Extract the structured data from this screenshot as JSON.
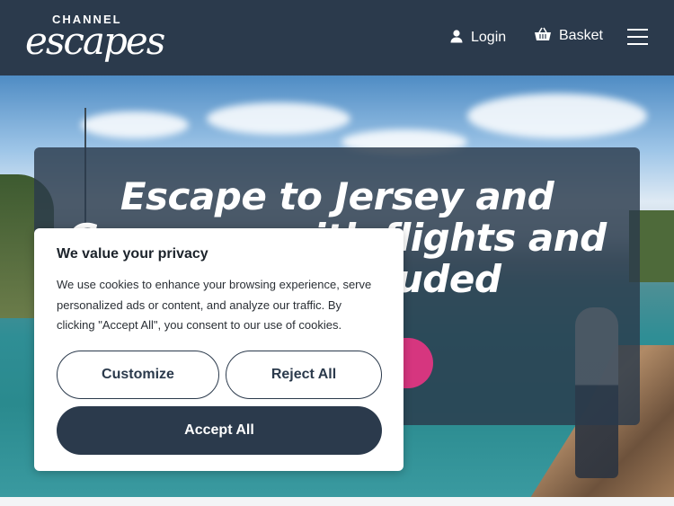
{
  "header": {
    "logo": {
      "top_text": "CHANNEL",
      "main_text": "escapes"
    },
    "login_label": "Login",
    "basket_label": "Basket",
    "icons": {
      "login": "user-icon",
      "basket": "basket-icon",
      "menu": "hamburger-menu-icon"
    }
  },
  "hero": {
    "title_lines": [
      "Escape to Jersey and",
      "Guernsey with flights and",
      "ferries included"
    ]
  },
  "cookie_banner": {
    "title": "We value your privacy",
    "body": "We use cookies to enhance your browsing experience, serve personalized ads or content, and analyze our traffic. By clicking \"Accept All\", you consent to our use of cookies.",
    "customize_label": "Customize",
    "reject_label": "Reject All",
    "accept_label": "Accept All"
  },
  "colors": {
    "navy": "#2b3a4c",
    "accent_pink": "#d6367f",
    "white": "#ffffff"
  }
}
